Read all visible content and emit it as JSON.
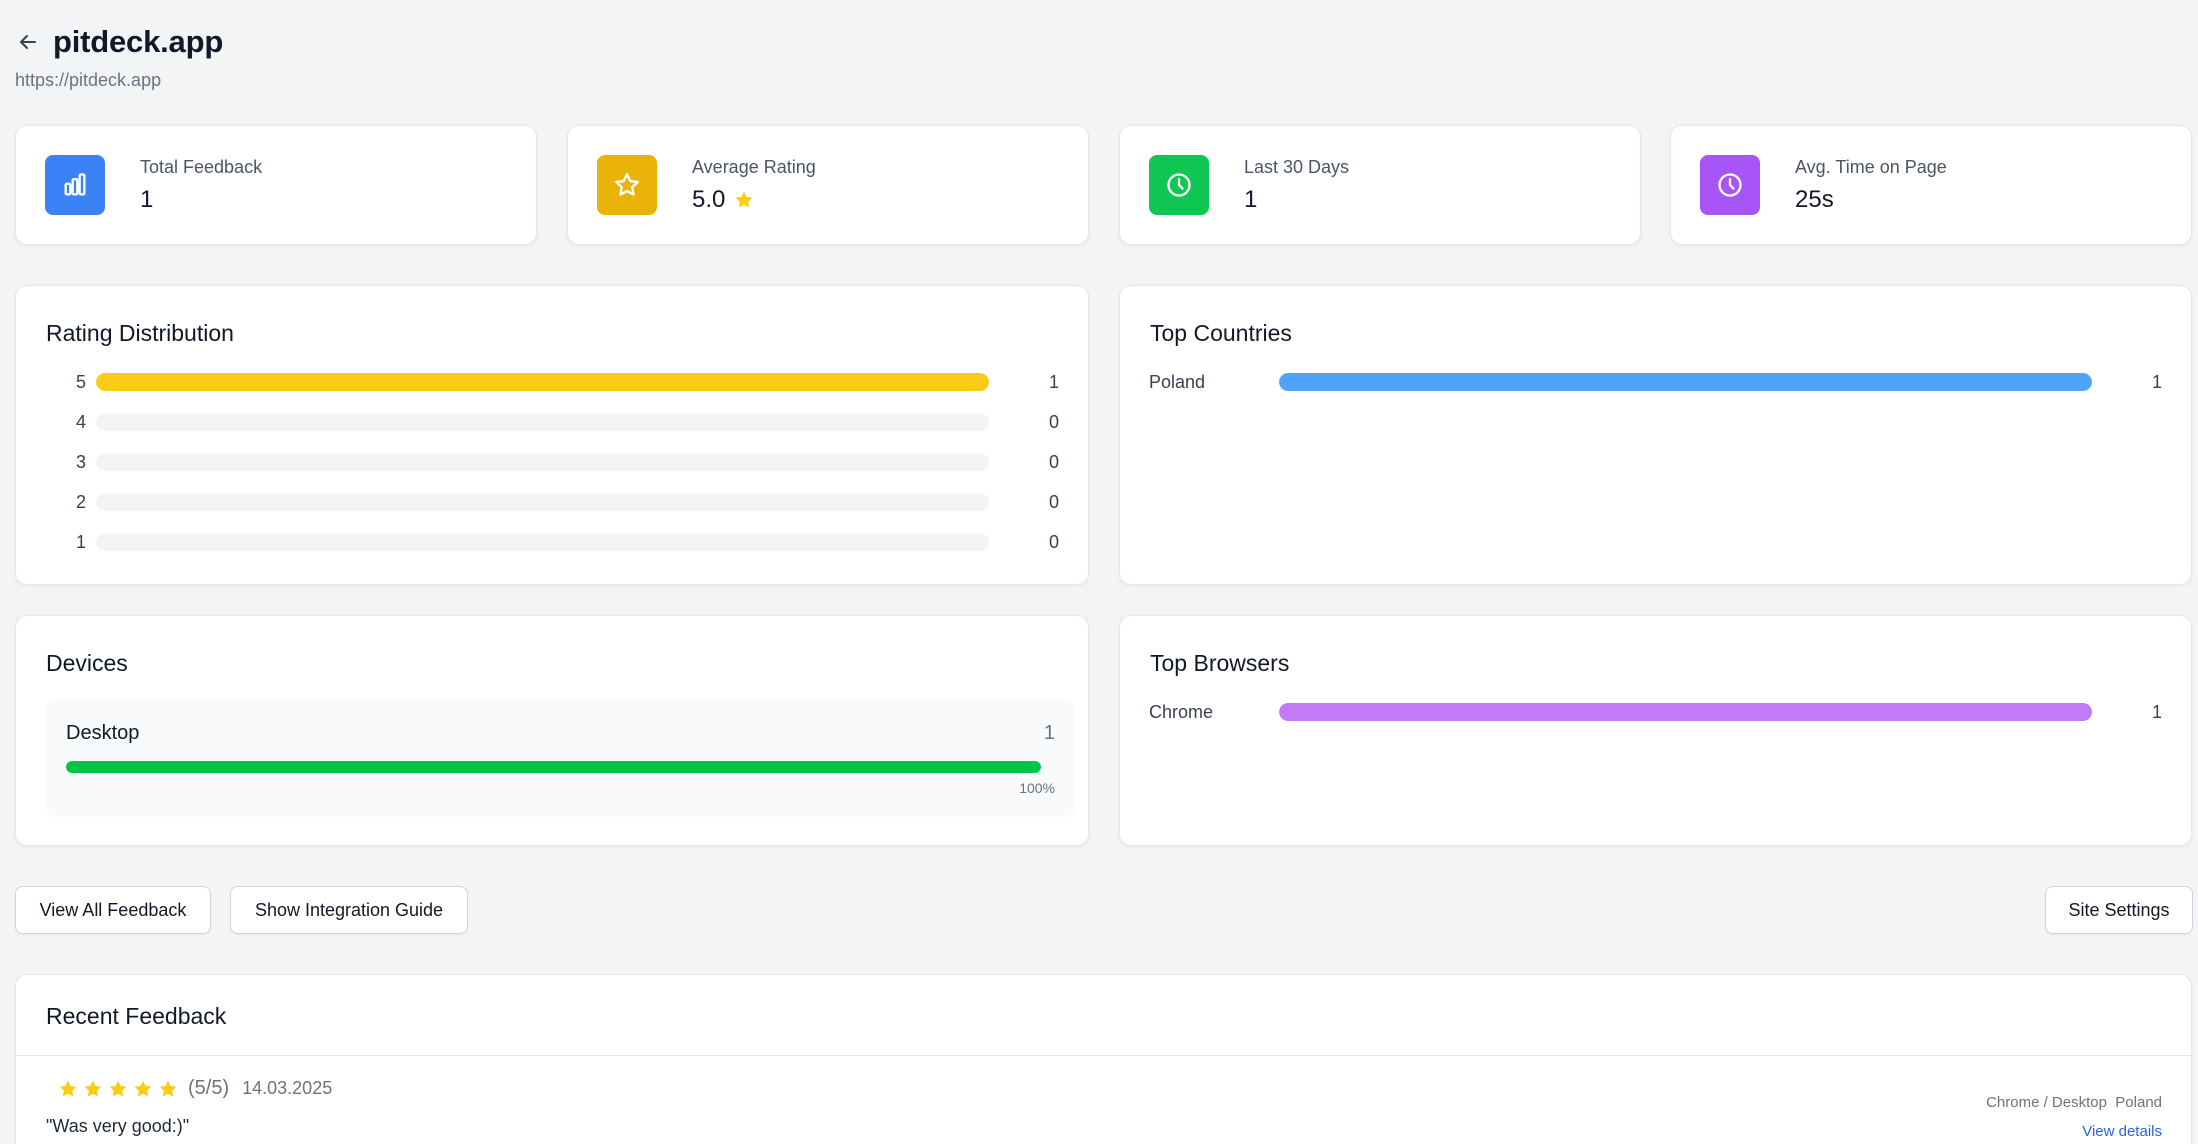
{
  "header": {
    "title": "pitdeck.app",
    "url": "https://pitdeck.app",
    "back_icon": "arrow-left-icon"
  },
  "colors": {
    "blue": "#3b82f6",
    "amber": "#eab308",
    "green": "#10c652",
    "purple": "#a855f7",
    "star": "#facc15",
    "country_bar": "#4fa3fb",
    "browser_bar": "#c27af9",
    "device_bar": "#00c447",
    "link": "#2563eb"
  },
  "stats": [
    {
      "label": "Total Feedback",
      "value": "1",
      "icon": "bar-chart-icon"
    },
    {
      "label": "Average Rating",
      "value": "5.0",
      "icon": "star-icon"
    },
    {
      "label": "Last 30 Days",
      "value": "1",
      "icon": "clock-icon"
    },
    {
      "label": "Avg. Time on Page",
      "value": "25s",
      "icon": "clock-icon"
    }
  ],
  "rating_distribution": {
    "title": "Rating Distribution",
    "rows": [
      {
        "label": "5",
        "count": "1",
        "fraction": 1.0
      },
      {
        "label": "4",
        "count": "0",
        "fraction": 0
      },
      {
        "label": "3",
        "count": "0",
        "fraction": 0
      },
      {
        "label": "2",
        "count": "0",
        "fraction": 0
      },
      {
        "label": "1",
        "count": "0",
        "fraction": 0
      }
    ]
  },
  "top_countries": {
    "title": "Top Countries",
    "rows": [
      {
        "label": "Poland",
        "count": "1",
        "fraction": 1.0
      }
    ]
  },
  "devices": {
    "title": "Devices",
    "items": [
      {
        "label": "Desktop",
        "count": "1",
        "percent": "100%",
        "fraction": 1.0
      }
    ]
  },
  "top_browsers": {
    "title": "Top Browsers",
    "rows": [
      {
        "label": "Chrome",
        "count": "1",
        "fraction": 1.0
      }
    ]
  },
  "actions": {
    "view_all": "View All Feedback",
    "integration": "Show Integration Guide",
    "settings": "Site Settings"
  },
  "recent_feedback": {
    "title": "Recent Feedback",
    "items": [
      {
        "stars": 5,
        "score": "(5/5)",
        "date": "14.03.2025",
        "text": "\"Was very good:)\"",
        "meta": "Chrome / Desktop  Poland",
        "link": "View details"
      }
    ]
  }
}
